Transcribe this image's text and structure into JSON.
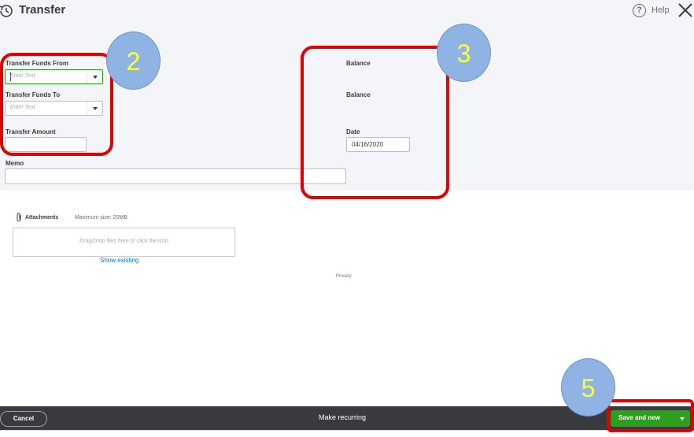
{
  "header": {
    "title": "Transfer",
    "help_label": "Help"
  },
  "form": {
    "from": {
      "label": "Transfer Funds From",
      "placeholder": "Enter Text"
    },
    "to": {
      "label": "Transfer Funds To",
      "placeholder": "Enter Text"
    },
    "amount": {
      "label": "Transfer Amount",
      "value": ""
    },
    "memo": {
      "label": "Memo",
      "value": ""
    },
    "balance_from_label": "Balance",
    "balance_to_label": "Balance",
    "date": {
      "label": "Date",
      "value": "04/16/2020"
    }
  },
  "attachments": {
    "label": "Attachments",
    "max_size": "Maximum size: 20MB",
    "dropzone_text": "Drag/Drop files here or click the icon",
    "show_existing": "Show existing"
  },
  "privacy": "Privacy",
  "footer": {
    "cancel": "Cancel",
    "make_recurring": "Make recurring",
    "save": "Save and new"
  },
  "annotations": {
    "badge_left": "2",
    "badge_middle": "3",
    "badge_save": "5",
    "color": "#e00000"
  },
  "colors": {
    "accent_green": "#2ca01c",
    "link_blue": "#0077c5",
    "footer_bg": "#393a3d"
  }
}
